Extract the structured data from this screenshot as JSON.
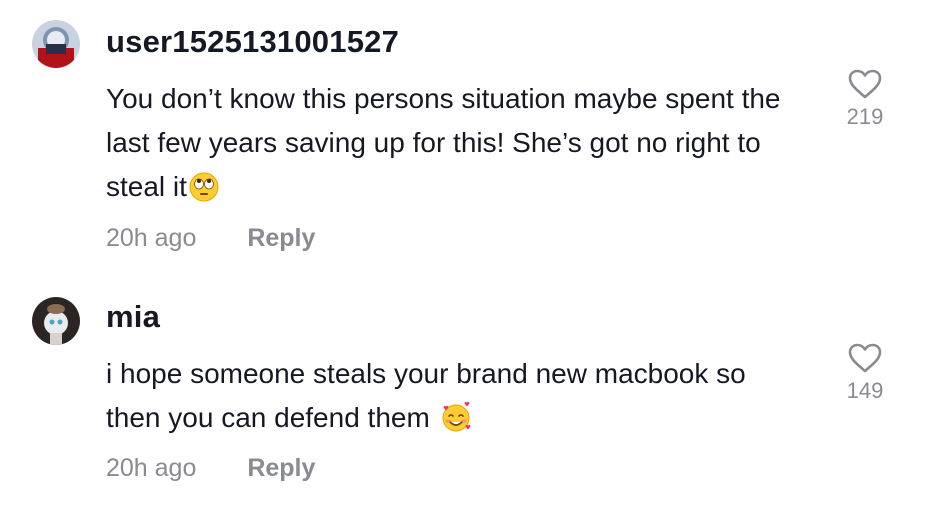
{
  "comments": [
    {
      "username": "user1525131001527",
      "text": "You don’t know this persons situation maybe spent the last few years saving up for this! She’s got no right to steal it",
      "emoji": "face-with-rolling-eyes",
      "time": "20h ago",
      "reply_label": "Reply",
      "likes": "219"
    },
    {
      "username": "mia",
      "text": "i hope someone steals your brand new macbook so then you can defend them ",
      "emoji": "smiling-face-with-hearts",
      "time": "20h ago",
      "reply_label": "Reply",
      "likes": "149"
    }
  ],
  "icons": {
    "like": "heart-outline-icon"
  },
  "colors": {
    "primary_text": "#161823",
    "secondary_text": "#8a8b91",
    "background": "#ffffff"
  }
}
